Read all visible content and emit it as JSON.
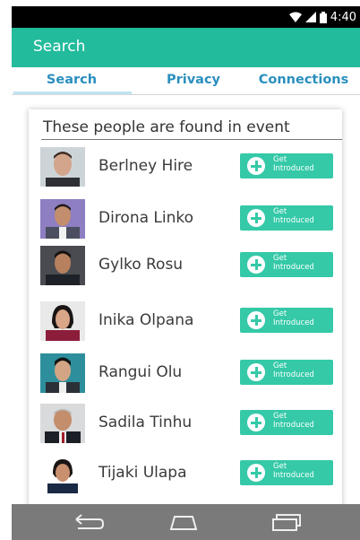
{
  "status_bar": {
    "time": "4:40"
  },
  "app_bar": {
    "title": "Search"
  },
  "tabs": [
    {
      "label": "Search",
      "selected": true
    },
    {
      "label": "Privacy",
      "selected": false
    },
    {
      "label": "Connections",
      "selected": false
    }
  ],
  "results": {
    "header": "These people are found in event",
    "button_label_top": "Get",
    "button_label_bottom": "Introduced",
    "people": [
      {
        "name": "Berlney Hire"
      },
      {
        "name": "Dirona Linko"
      },
      {
        "name": "Gylko Rosu"
      },
      {
        "name": "Inika Olpana"
      },
      {
        "name": "Rangui Olu"
      },
      {
        "name": "Sadila Tinhu"
      },
      {
        "name": "Tijaki Ulapa"
      }
    ]
  },
  "colors": {
    "accent": "#22bb9c",
    "button": "#35c9a8",
    "tab_text": "#2a8fbe",
    "nav_bar": "#7a7a7a"
  },
  "icons": {
    "status": [
      "wifi-icon",
      "signal-icon",
      "battery-icon"
    ],
    "nav": [
      "back-icon",
      "home-icon",
      "recents-icon"
    ],
    "button": "plus-circle-icon"
  }
}
